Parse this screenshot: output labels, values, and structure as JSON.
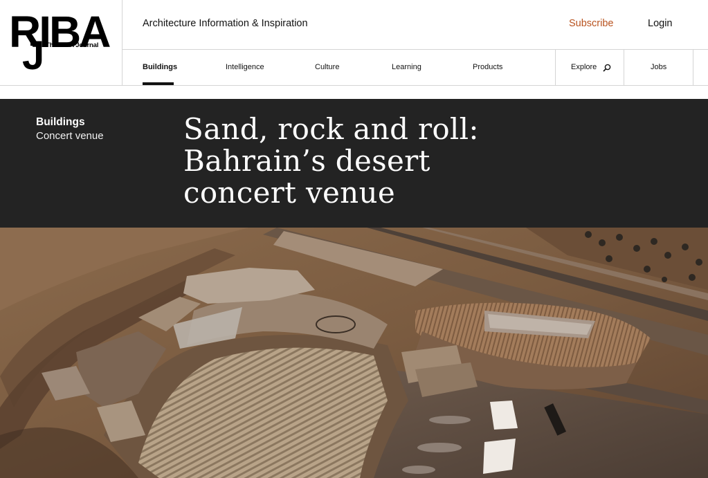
{
  "logo": {
    "main": "RIBA",
    "j": "J",
    "tagline": "The RIBA Journal"
  },
  "header": {
    "description": "Architecture Information & Inspiration",
    "subscribe_label": "Subscribe",
    "login_label": "Login",
    "subscribe_color": "#b8521e"
  },
  "nav": {
    "items": [
      {
        "label": "Buildings",
        "active": true
      },
      {
        "label": "Intelligence"
      },
      {
        "label": "Culture"
      },
      {
        "label": "Learning"
      },
      {
        "label": "Products"
      }
    ],
    "explore_label": "Explore",
    "explore_icon": "search-icon",
    "jobs_label": "Jobs"
  },
  "article": {
    "section": "Buildings",
    "subsection": "Concert venue",
    "title": "Sand, rock and roll: Bahrain’s desert concert venue",
    "band_color": "#232323"
  },
  "hero": {
    "subject": "aerial photograph of desert amphitheatre"
  }
}
